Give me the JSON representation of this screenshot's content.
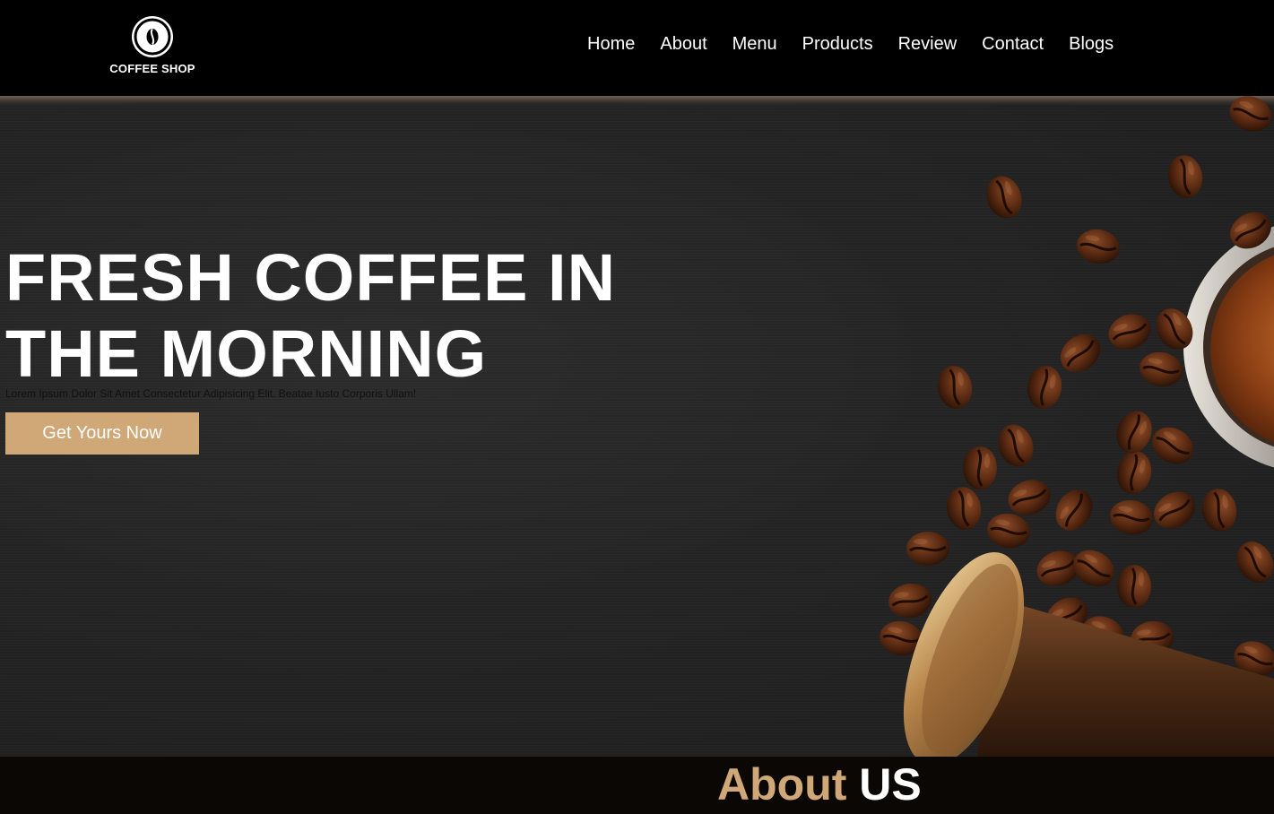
{
  "brand": {
    "name": "COFFEE SHOP"
  },
  "nav": {
    "items": [
      {
        "label": "Home"
      },
      {
        "label": "About"
      },
      {
        "label": "Menu"
      },
      {
        "label": "Products"
      },
      {
        "label": "Review"
      },
      {
        "label": "Contact"
      },
      {
        "label": "Blogs"
      }
    ]
  },
  "hero": {
    "title": "FRESH COFFEE IN THE MORNING",
    "subtitle": "Lorem Ipsum Dolor Sit Amet Consectetur Adipisicing Elit. Beatae Iusto Corporis Ullam!",
    "cta_label": "Get Yours Now"
  },
  "about": {
    "title_first": "About",
    "title_second": "US"
  },
  "colors": {
    "accent": "#d0a877",
    "header_bg": "#000000",
    "hero_bg": "#242424"
  }
}
